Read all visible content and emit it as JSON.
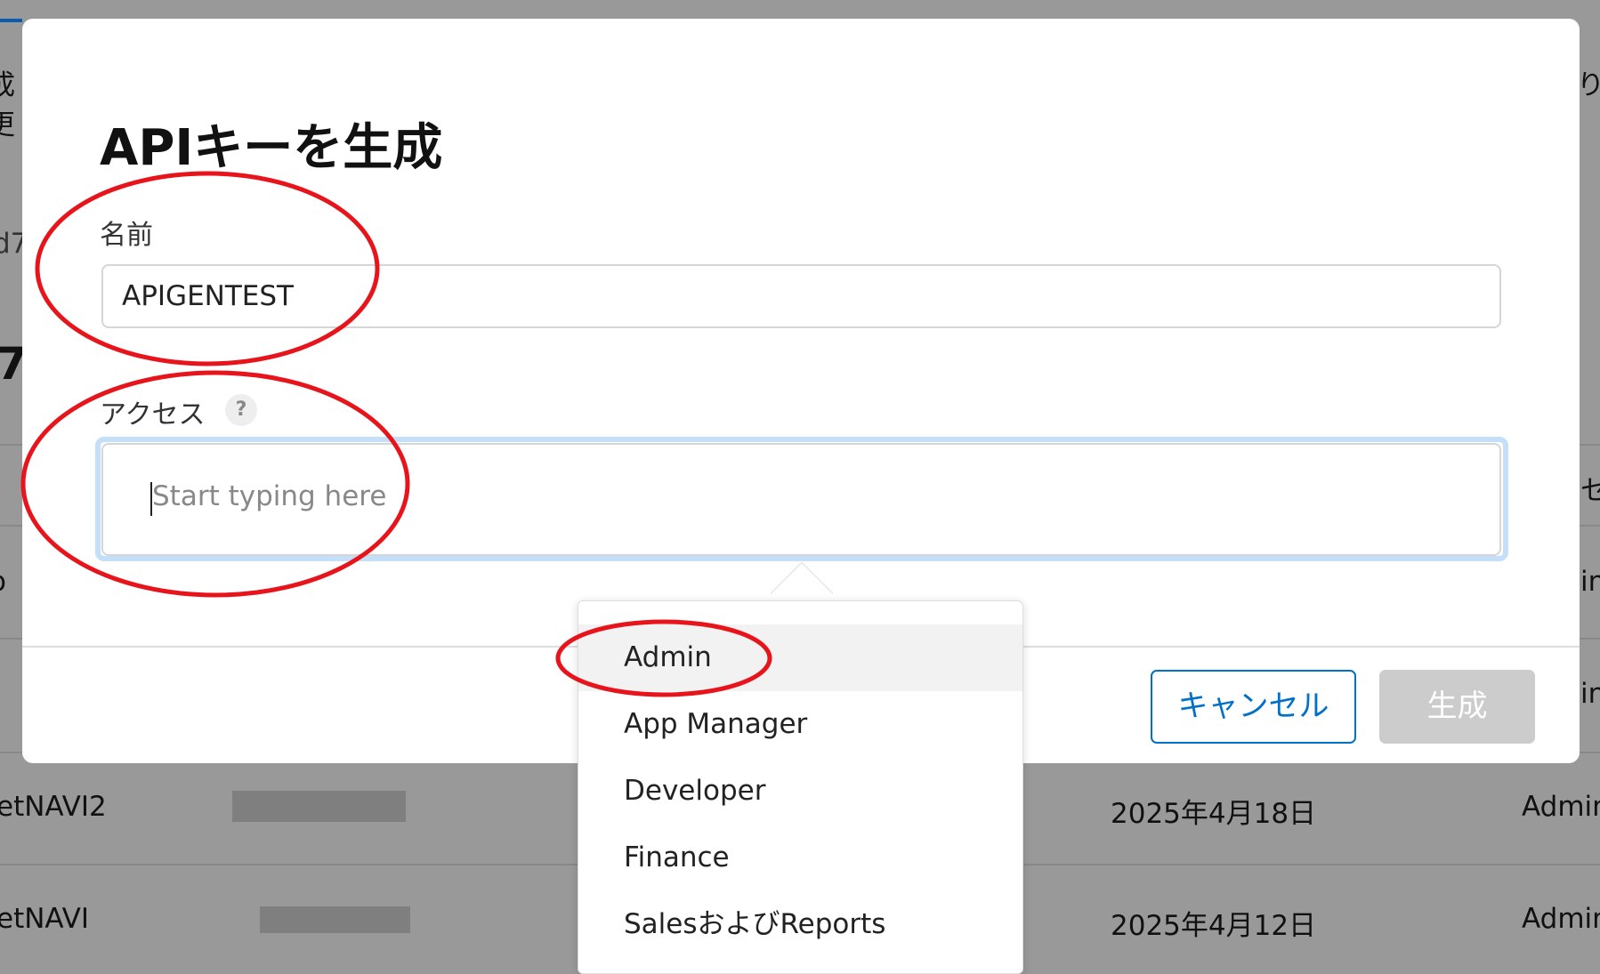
{
  "background": {
    "left_fragments": [
      "成",
      "更",
      "d7",
      "7",
      "o"
    ],
    "right_fragments": [
      "り",
      "セ",
      "in",
      "in"
    ],
    "rows": [
      {
        "name": "etNAVI2",
        "date": "2025年4月18日",
        "role": "Admin"
      },
      {
        "name": "etNAVI",
        "date": "2025年4月12日",
        "role": "Admin"
      }
    ]
  },
  "modal": {
    "title": "APIキーを生成",
    "name_label": "名前",
    "name_value": "APIGENTEST",
    "access_label": "アクセス",
    "help_icon": "?",
    "access_placeholder": "Start typing here",
    "cancel_label": "キャンセル",
    "generate_label": "生成"
  },
  "dropdown": {
    "items": [
      "Admin",
      "App Manager",
      "Developer",
      "Finance",
      "SalesおよびReports"
    ],
    "highlighted": "Admin"
  },
  "colors": {
    "accent": "#0070c9",
    "annotation": "#e8141c",
    "overlay": "#999999"
  }
}
